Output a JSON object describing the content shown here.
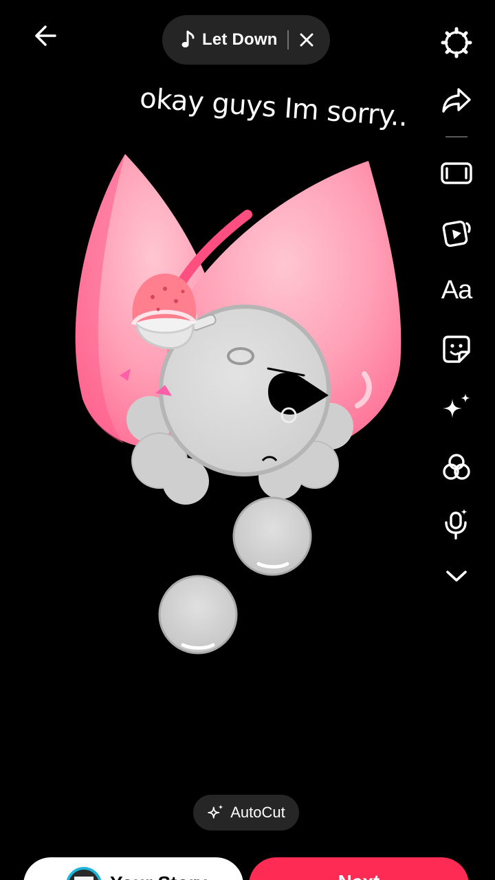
{
  "header": {
    "back_icon": "arrow-left-icon",
    "music": {
      "icon": "music-note-icon",
      "title": "Let Down",
      "close_icon": "close-icon"
    }
  },
  "caption": "okay guys Im sorry..",
  "toolbar": {
    "items": [
      {
        "name": "settings",
        "icon": "gear-icon"
      },
      {
        "name": "share",
        "icon": "share-arrow-icon"
      },
      {
        "name": "aspect",
        "icon": "aspect-ratio-icon"
      },
      {
        "name": "templates",
        "icon": "video-template-icon"
      },
      {
        "name": "text",
        "label": "Aa"
      },
      {
        "name": "stickers",
        "icon": "sticker-icon"
      },
      {
        "name": "effects",
        "icon": "sparkles-icon"
      },
      {
        "name": "filters",
        "icon": "filters-icon"
      },
      {
        "name": "voice",
        "icon": "voice-effect-icon"
      },
      {
        "name": "more",
        "icon": "chevron-down-icon"
      }
    ]
  },
  "autocut": {
    "icon": "sparkles-icon",
    "label": "AutoCut"
  },
  "footer": {
    "story_label": "Your Story",
    "next_label": "Next"
  },
  "colors": {
    "accent": "#fe2c55",
    "story_ring": "#1fb5d8",
    "pill_bg": "#282828"
  }
}
